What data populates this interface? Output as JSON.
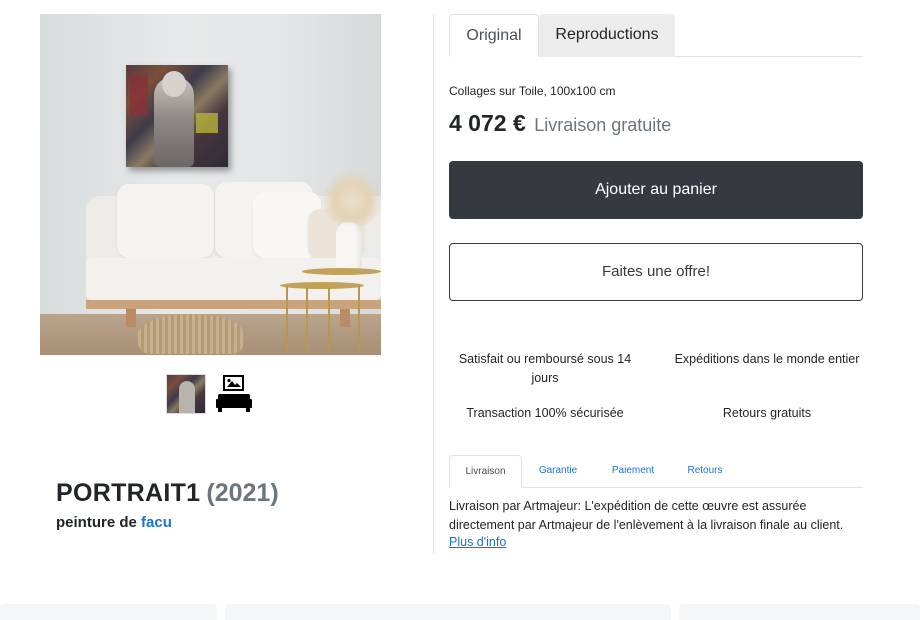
{
  "artwork": {
    "title": "PORTRAIT1",
    "year": "(2021)",
    "byline_prefix": "peinture de",
    "artist": "facu",
    "medium": "Collages sur Toile, 100x100 cm",
    "price": "4 072 €",
    "shipping": "Livraison gratuite"
  },
  "tabs": {
    "original": "Original",
    "reproductions": "Reproductions"
  },
  "buttons": {
    "add_to_cart": "Ajouter au panier",
    "make_offer": "Faites une offre!"
  },
  "guarantees": [
    "Satisfait ou remboursé sous 14 jours",
    "Expéditions dans le monde entier",
    "Transaction 100% sécurisée",
    "Retours gratuits"
  ],
  "info_tabs": [
    "Livraison",
    "Garantie",
    "Paiement",
    "Retours"
  ],
  "info": {
    "text": "Livraison par Artmajeur: L'expédition de cette œuvre est assurée directement par Artmajeur de l'enlèvement à la livraison finale au client.",
    "more_link": "Plus d'info"
  },
  "thumbnails": {
    "icons": [
      "painting-thumbnail",
      "room-view-icon"
    ]
  }
}
